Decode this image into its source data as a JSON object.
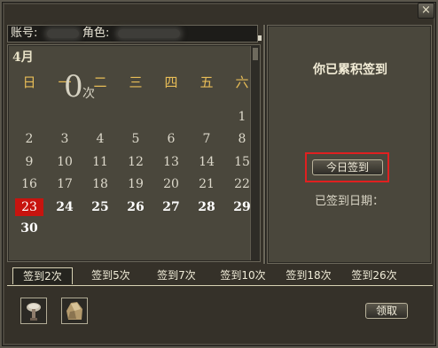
{
  "window": {
    "close_label": "×"
  },
  "account": {
    "account_label": "账号:",
    "role_label": "角色:"
  },
  "calendar": {
    "month": "4月",
    "weekdays": [
      "日",
      "一",
      "二",
      "三",
      "四",
      "五",
      "六"
    ],
    "today": "23",
    "days_past": [
      "1",
      "2",
      "3",
      "4",
      "5",
      "6",
      "7",
      "8",
      "9",
      "10",
      "11",
      "12",
      "13",
      "14",
      "15",
      "16",
      "17",
      "18",
      "19",
      "20",
      "21",
      "22"
    ],
    "days_future": [
      "24",
      "25",
      "26",
      "27",
      "28",
      "29",
      "30"
    ]
  },
  "sign": {
    "title": "你已累积签到",
    "count": "0",
    "unit": "次",
    "button_label": "今日签到",
    "signed_dates_label": "已签到日期："
  },
  "tabs": [
    "签到2次",
    "签到5次",
    "签到7次",
    "签到10次",
    "签到18次",
    "签到26次"
  ],
  "active_tab": 0,
  "rewards": [
    {
      "icon": "mushroom-lamp-icon"
    },
    {
      "icon": "ore-stone-icon"
    }
  ],
  "claim_label": "领取",
  "colors": {
    "today_highlight": "#c7140f",
    "weekday_text": "#e8bd57",
    "focus_box": "#e02020"
  }
}
